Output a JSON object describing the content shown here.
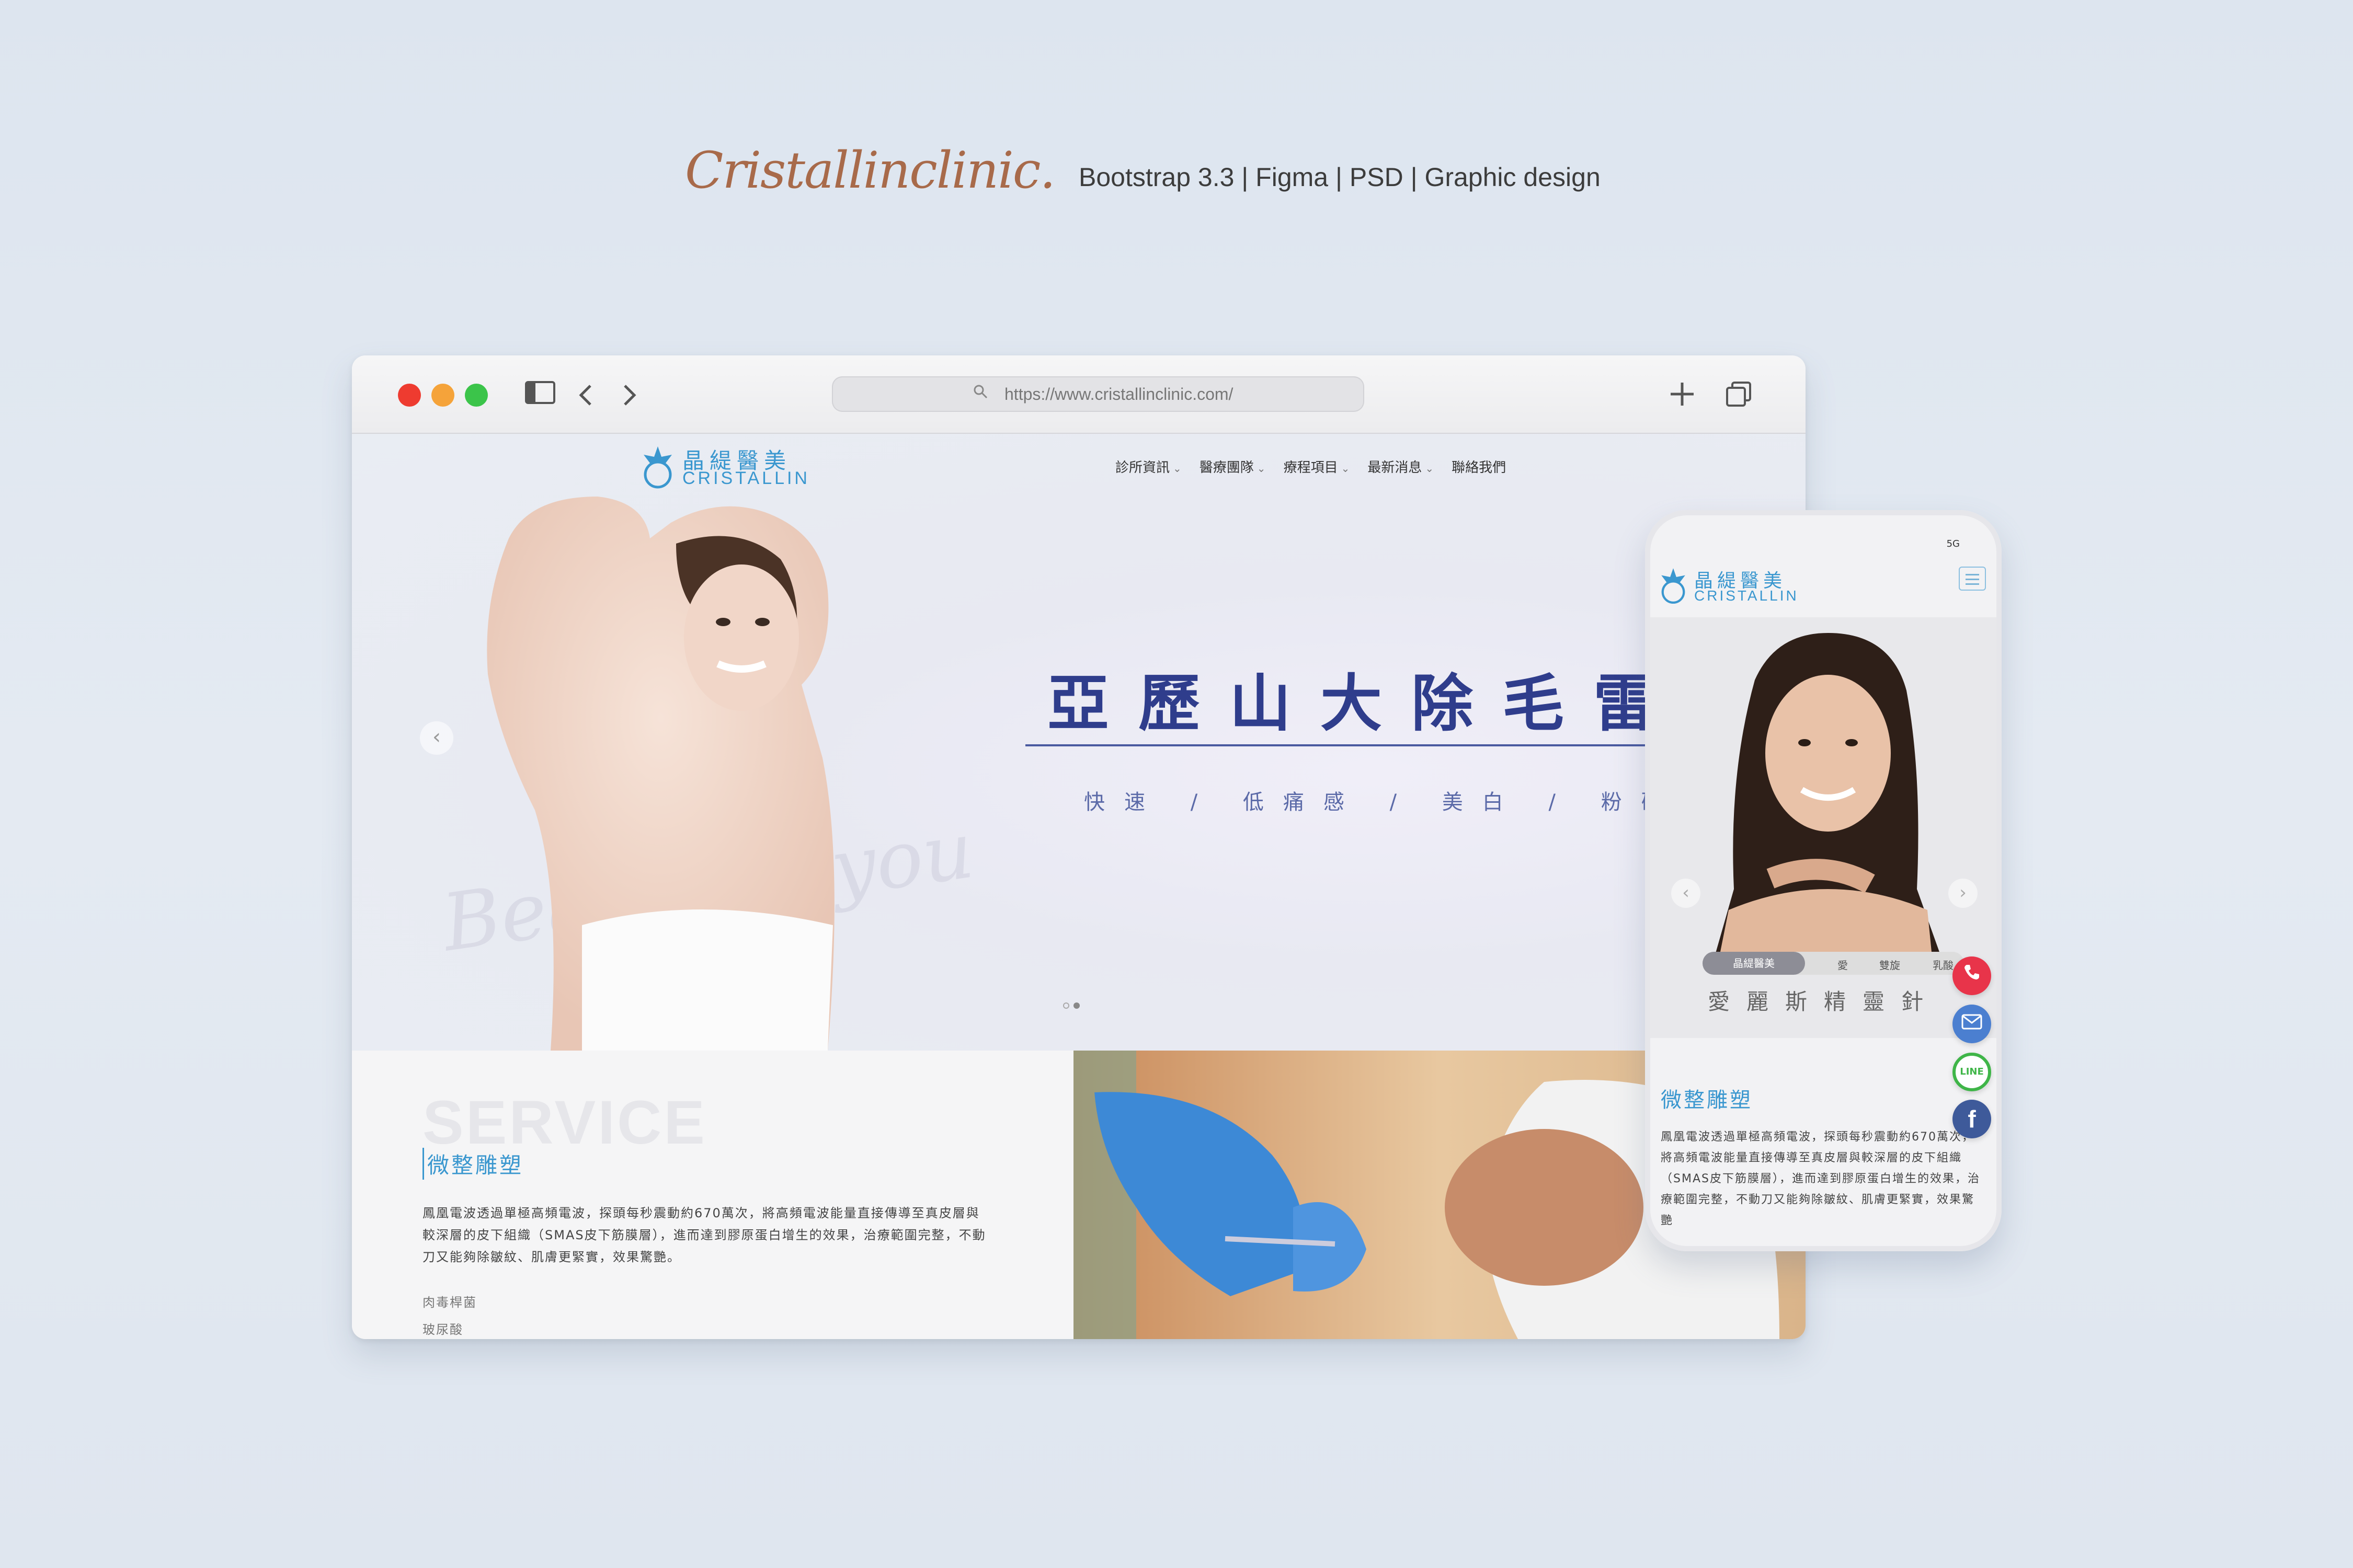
{
  "header": {
    "brand": "Cristallinclinic.",
    "tagline": "Bootstrap 3.3 | Figma | PSD | Graphic design"
  },
  "browser": {
    "url": "https://www.cristallinclinic.com/",
    "icons": {
      "sidebar": "sidebar-icon",
      "back": "chevron-left-icon",
      "forward": "chevron-right-icon",
      "new_tab": "plus-icon",
      "tabs": "tabs-icon",
      "search": "search-icon"
    }
  },
  "site": {
    "logo_cn": "晶緹醫美",
    "logo_en": "CRISTALLIN",
    "nav": [
      {
        "label": "診所資訊",
        "has_dropdown": true
      },
      {
        "label": "醫療團隊",
        "has_dropdown": true
      },
      {
        "label": "療程項目",
        "has_dropdown": true
      },
      {
        "label": "最新消息",
        "has_dropdown": true
      },
      {
        "label": "聯絡我們",
        "has_dropdown": false
      }
    ],
    "hero": {
      "title": "亞歷山大除毛雷",
      "subtitle": "快速 / 低痛感 / 美白 / 粉碎黑色",
      "watermark": "Beauty is you",
      "slides": 2,
      "active_slide": 2
    },
    "service": {
      "bg_label": "SERVICE",
      "title": "微整雕塑",
      "text": "鳳凰電波透過單極高頻電波，探頭每秒震動約670萬次，將高頻電波能量直接傳導至真皮層與較深層的皮下組織（SMAS皮下筋膜層），進而達到膠原蛋白增生的效果，治療範圍完整，不動刀又能夠除皺紋、肌膚更緊實，效果驚艷。",
      "links": [
        "肉毒桿菌",
        "玻尿酸"
      ]
    }
  },
  "mobile": {
    "status": "5G",
    "logo_cn": "晶緹醫美",
    "logo_en": "CRISTALLIN",
    "tabs": [
      "晶緹醫美",
      "愛",
      "雙旋",
      "乳酸"
    ],
    "caption": "愛麗斯精靈針",
    "service_title": "微整雕塑",
    "service_text": "鳳凰電波透過單極高頻電波，探頭每秒震動約670萬次，將高頻電波能量直接傳導至真皮層與較深層的皮下組織（SMAS皮下筋膜層），進而達到膠原蛋白增生的效果，治療範圍完整，不動刀又能夠除皺紋、肌膚更緊實，效果驚艷",
    "fab": {
      "line_label": "LINE",
      "fb_label": "f"
    }
  },
  "colors": {
    "brand_blue": "#3a97cf",
    "hero_title": "#2f3d8c",
    "brand_script": "#a86a4a",
    "call": "#e8344a",
    "line": "#3fb548",
    "facebook": "#3e5a9a"
  }
}
